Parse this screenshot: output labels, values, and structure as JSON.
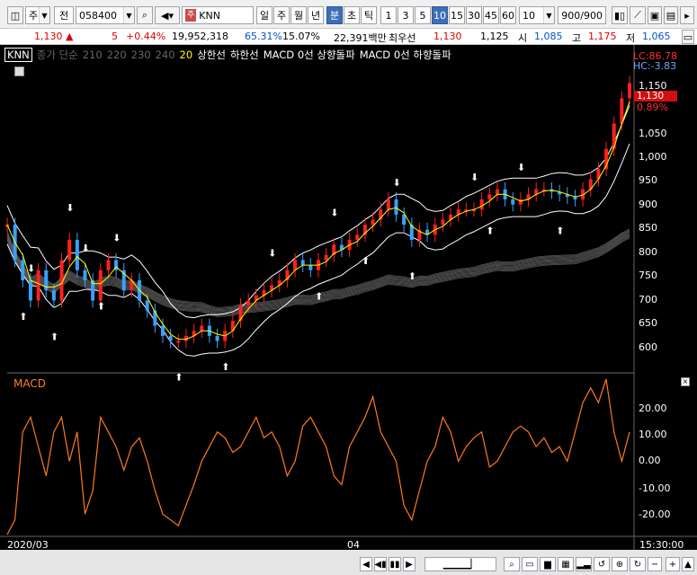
{
  "toolbar": {
    "market": "주",
    "jeon": "전",
    "code": "058400",
    "stock_tag": "주",
    "stock_name": "KNN",
    "periods": [
      "일",
      "주",
      "월",
      "년",
      "분",
      "초",
      "틱"
    ],
    "active_period": "분",
    "intervals": [
      "1",
      "3",
      "5",
      "10",
      "15",
      "30",
      "45",
      "60"
    ],
    "active_interval": "10",
    "interval_value": "10",
    "count": "900/900"
  },
  "quote": {
    "price": "1,130",
    "change": "5",
    "change_pct": "+0.44%",
    "volume": "19,952,318",
    "pct_a": "65.31%",
    "pct_b": "15.07%",
    "amount": "22,391백만",
    "label_best": "최우선",
    "best_ask": "1,130",
    "best_bid": "1,125",
    "label_open": "시",
    "open": "1,085",
    "label_high": "고",
    "high": "1,175",
    "label_low": "저",
    "low": "1,065"
  },
  "legend": {
    "stock": "KNN",
    "ma_label": "종가 단순",
    "ma_periods": [
      "210",
      "220",
      "230",
      "240"
    ],
    "ma_20": "20",
    "upper": "상한선",
    "lower": "하한선",
    "macd_up": "MACD 0선 상향돌파",
    "macd_down": "MACD 0선 하향돌파",
    "lc": "LC:86.78",
    "hc": "HC:-3.83"
  },
  "price_axis": {
    "current": "1,130",
    "top_tag": "1,150",
    "pct": "0.89%",
    "ticks": [
      "1,050",
      "1,000",
      "950",
      "900",
      "850",
      "800",
      "750",
      "700",
      "650",
      "600"
    ]
  },
  "macd": {
    "label": "MACD",
    "ticks": [
      "20.00",
      "10.00",
      "0.00",
      "-10.00",
      "-20.00"
    ]
  },
  "x_axis": {
    "left": "2020/03",
    "mid": "04",
    "right": "15:30:00"
  },
  "colors": {
    "up": "#ff2020",
    "down": "#3aa0ff",
    "macd": "#ff7a1a",
    "band": "#ffffff",
    "ma20": "#ffff00"
  },
  "chart_data": {
    "type": "line",
    "price_ylim": [
      580,
      1170
    ],
    "macd_ylim": [
      -25,
      28
    ],
    "close": [
      850,
      780,
      740,
      700,
      760,
      720,
      700,
      780,
      820,
      760,
      740,
      700,
      760,
      780,
      760,
      720,
      740,
      700,
      680,
      650,
      630,
      620,
      620,
      630,
      640,
      650,
      630,
      620,
      640,
      660,
      690,
      700,
      710,
      720,
      730,
      740,
      760,
      780,
      770,
      760,
      780,
      790,
      810,
      800,
      820,
      830,
      850,
      860,
      880,
      900,
      870,
      850,
      820,
      840,
      830,
      850,
      860,
      870,
      880,
      880,
      880,
      900,
      910,
      920,
      900,
      890,
      900,
      910,
      920,
      920,
      915,
      910,
      905,
      900,
      920,
      940,
      960,
      1000,
      1050,
      1100,
      1130
    ],
    "macd": [
      -25,
      -20,
      10,
      15,
      5,
      -5,
      10,
      15,
      0,
      10,
      -18,
      -10,
      15,
      10,
      5,
      -3,
      5,
      8,
      0,
      -10,
      -18,
      -20,
      -22,
      -15,
      -8,
      0,
      5,
      10,
      8,
      3,
      5,
      10,
      15,
      8,
      10,
      5,
      -5,
      0,
      12,
      15,
      10,
      5,
      -5,
      -8,
      5,
      10,
      15,
      22,
      10,
      5,
      0,
      -15,
      -20,
      -10,
      0,
      5,
      15,
      10,
      0,
      5,
      8,
      10,
      -2,
      0,
      5,
      10,
      12,
      10,
      5,
      8,
      3,
      5,
      0,
      10,
      20,
      25,
      20,
      28,
      10,
      0,
      10
    ]
  }
}
